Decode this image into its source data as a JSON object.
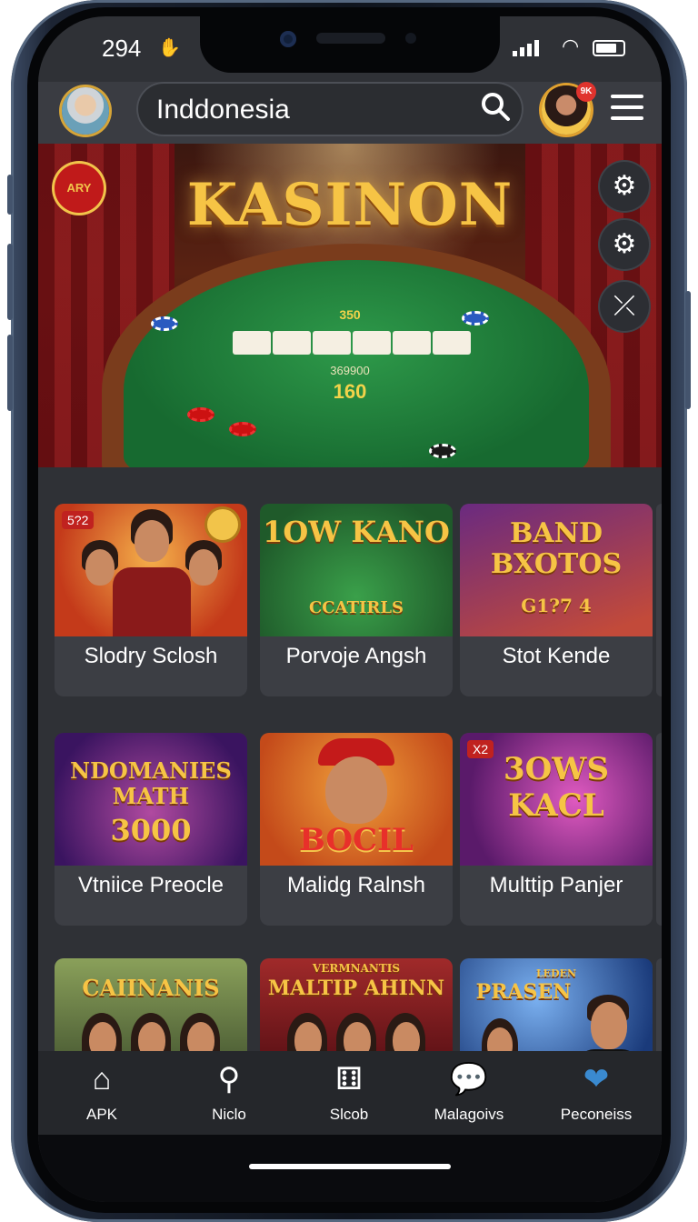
{
  "status_bar": {
    "time": "294",
    "hand_icon": "hand-icon",
    "wifi_icon": "wifi-icon",
    "signal_icon": "signal-icon",
    "battery_icon": "battery-icon"
  },
  "header": {
    "search_text": "Inddonesia",
    "search_icon": "search-icon",
    "badge_text": "9K",
    "menu_icon": "hamburger-menu-icon"
  },
  "banner": {
    "title": "KASINON",
    "corner_badge": "ARY",
    "felt_line1": "369900",
    "felt_line2": "160",
    "felt_top": "350",
    "fab_icons": [
      "settings-cog-icon",
      "gear-icon",
      "swap-icon"
    ]
  },
  "games": [
    {
      "title": "Slodry Sclosh",
      "art_text": "",
      "corner": "5?2",
      "colors": [
        "#c43a1a",
        "#f08a2a"
      ]
    },
    {
      "title": "Porvoje Angsh",
      "art_text": "1OW KANO",
      "art_sub": "CCATIRLS",
      "colors": [
        "#1f6a2f",
        "#3aa04a"
      ]
    },
    {
      "title": "Stot Kende",
      "art_text": "BAND BXOTOS",
      "art_sub": "G1?7 4",
      "colors": [
        "#5a2a6a",
        "#c24a3a"
      ]
    },
    {
      "title": "Vtniice Preocle",
      "art_text": "NDOMANIES MATH",
      "art_sub": "3000",
      "colors": [
        "#4a1a6a",
        "#8a3aa0"
      ]
    },
    {
      "title": "Malidg Ralnsh",
      "art_text": "BOCIL",
      "colors": [
        "#c44a1a",
        "#f0a03a"
      ]
    },
    {
      "title": "Multtip Panjer",
      "art_text": "3OWS KACL",
      "corner": "X2",
      "colors": [
        "#5a1a6a",
        "#c23aa0"
      ]
    },
    {
      "title": "",
      "art_text": "CAIINANIS",
      "colors": [
        "#4a6a3a",
        "#a0b05a"
      ]
    },
    {
      "title": "",
      "art_text": "MALTIP AHINN",
      "art_sub": "VERMNANTIS",
      "colors": [
        "#6a0e16",
        "#a02a2a"
      ]
    },
    {
      "title": "",
      "art_text": "PRASEN",
      "art_sub": "LEDEN",
      "colors": [
        "#1a3a7a",
        "#3a7ad0"
      ]
    }
  ],
  "nav": [
    {
      "label": "APK",
      "icon": "home-icon"
    },
    {
      "label": "Niclo",
      "icon": "search-icon"
    },
    {
      "label": "Slcob",
      "icon": "dice-icon"
    },
    {
      "label": "Malagoivs",
      "icon": "chat-bubble-icon"
    },
    {
      "label": "Peconeiss",
      "icon": "profile-heart-icon"
    }
  ]
}
